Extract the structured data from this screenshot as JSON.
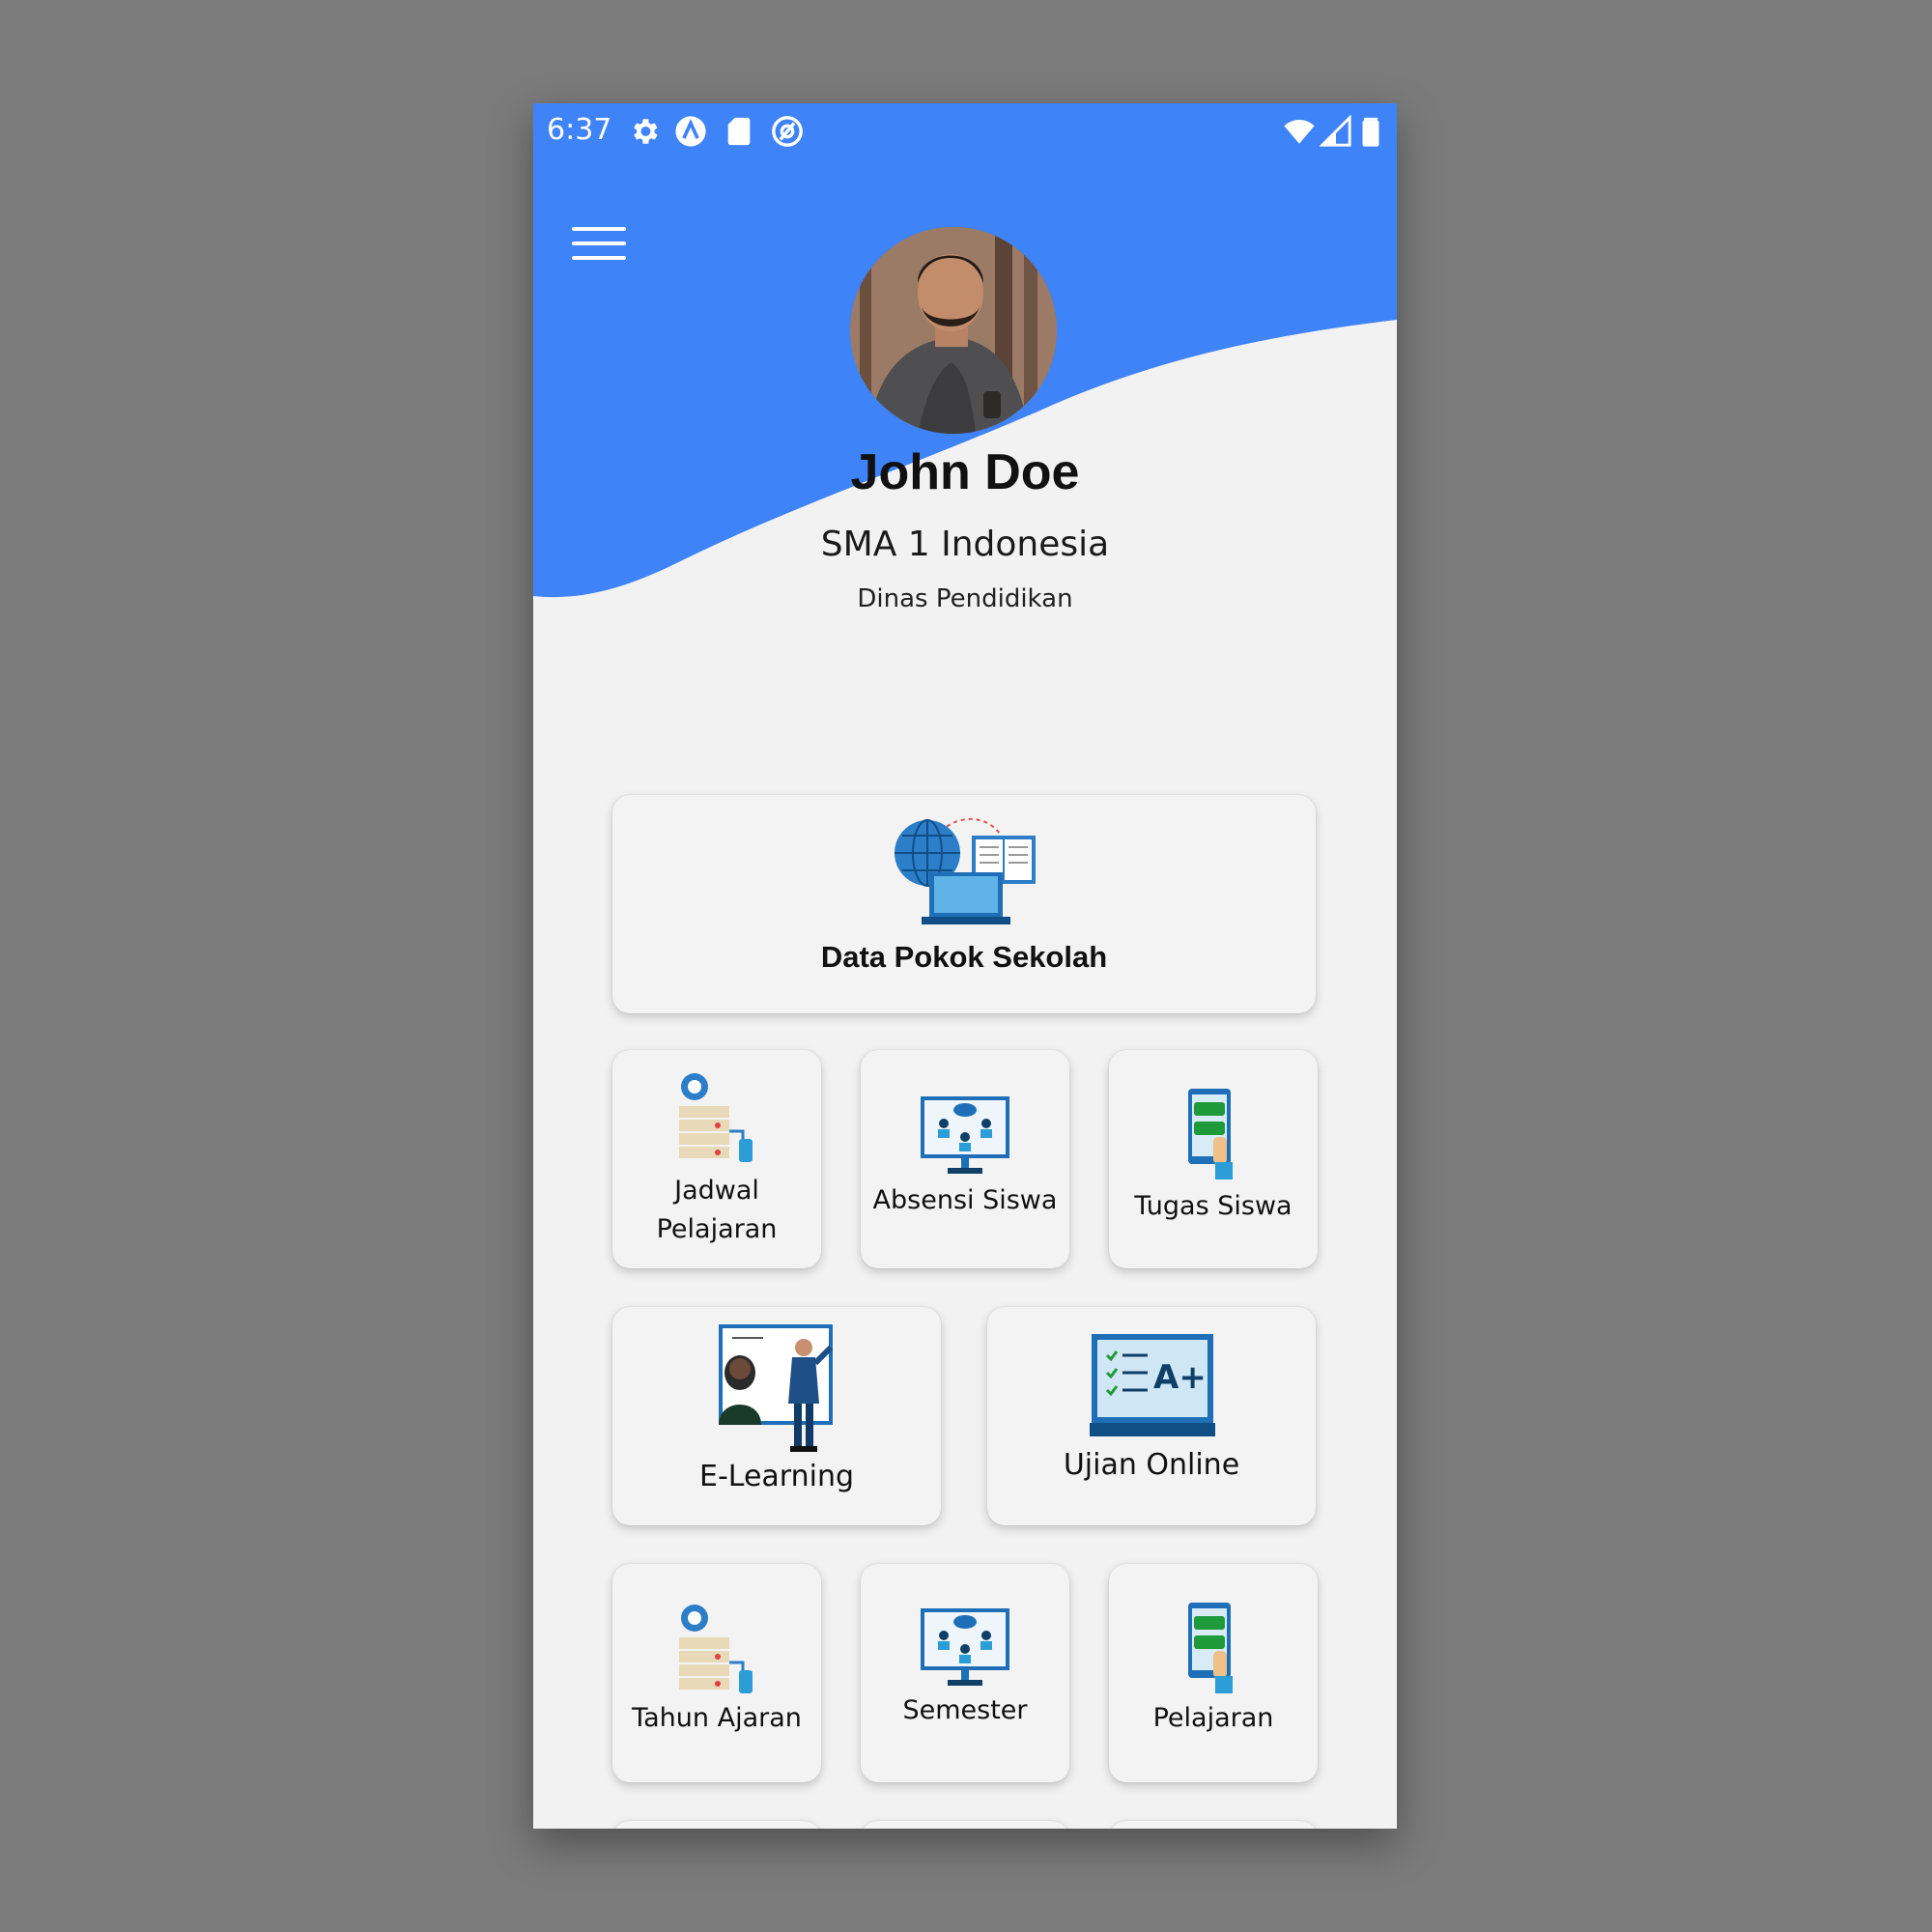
{
  "status_bar": {
    "time": "6:37",
    "left_icons": [
      "gear-icon",
      "a-logo-icon",
      "sd-card-icon",
      "at-sign-icon"
    ],
    "right_icons": [
      "wifi-icon",
      "signal-icon",
      "battery-icon"
    ]
  },
  "profile": {
    "name": "John Doe",
    "school": "SMA 1 Indonesia",
    "agency": "Dinas Pendidikan"
  },
  "menu": {
    "featured": {
      "label": "Data Pokok Sekolah",
      "icon": "globe-laptop-book-icon"
    },
    "row1": [
      {
        "label_line1": "Jadwal",
        "label_line2": "Pelajaran",
        "icon": "server-stack-icon"
      },
      {
        "label": "Absensi Siswa",
        "icon": "monitor-classroom-icon"
      },
      {
        "label": "Tugas Siswa",
        "icon": "phone-checklist-icon"
      }
    ],
    "row2": [
      {
        "label": "E-Learning",
        "icon": "teacher-board-icon"
      },
      {
        "label": "Ujian Online",
        "icon": "laptop-grade-icon"
      }
    ],
    "row3": [
      {
        "label": "Tahun Ajaran",
        "icon": "server-stack-icon"
      },
      {
        "label": "Semester",
        "icon": "monitor-classroom-icon"
      },
      {
        "label": "Pelajaran",
        "icon": "phone-checklist-icon"
      }
    ]
  },
  "colors": {
    "header_blue": "#3f83f8",
    "background": "#f2f2f2",
    "frame_gray": "#7b7b7b"
  }
}
